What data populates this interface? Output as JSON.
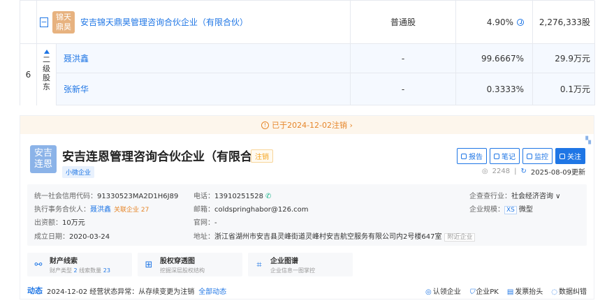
{
  "table": {
    "row1": {
      "logo_text": "锦天鼎昊",
      "collapse_symbol": "−",
      "name": "安吉锦天鼎昊管理咨询合伙企业（有限合伙）",
      "type": "普通股",
      "percent": "4.90%",
      "amount": "2,276,333股"
    },
    "index": "6",
    "level_label": "二级股东",
    "sub_rows": [
      {
        "name": "聂洪鑫",
        "type": "-",
        "percent": "99.6667%",
        "amount": "29.9万元"
      },
      {
        "name": "张新华",
        "type": "-",
        "percent": "0.3333%",
        "amount": "0.1万元"
      }
    ]
  },
  "card": {
    "banner": "已于2024-12-02注销 ›",
    "logo_text": "安吉连恩",
    "name": "安吉连恩管理咨询合伙企业（有限合伙）",
    "status_tag": "注销",
    "type_tag": "小微企业",
    "actions": [
      "报告",
      "笔记",
      "监控",
      "关注"
    ],
    "views": "2248",
    "updated": "2025-08-09更新",
    "info": {
      "credit_code_label": "统一社会信用代码：",
      "credit_code": "91330523MA2D1H6J89",
      "partner_label": "执行事务合伙人：",
      "partner": "聂洪鑫",
      "partner_tag": "关联企业 27",
      "capital_label": "出资额：",
      "capital": "10万元",
      "founded_label": "成立日期：",
      "founded": "2020-03-24",
      "phone_label": "电话：",
      "phone": "13910251528",
      "email_label": "邮箱：",
      "email": "coldspringhabor@126.com",
      "website_label": "官网：",
      "website": "-",
      "address_label": "地址：",
      "address": "浙江省湖州市安吉县灵峰街道灵峰村安吉航空服务有限公司内2号楼647室",
      "nearby": "附近企业",
      "industry_label": "企查查行业：",
      "industry": "社会经济咨询 ∨",
      "scale_label": "企业规模：",
      "scale_tag": "XS",
      "scale": "微型"
    },
    "features": [
      {
        "title": "财产线索",
        "sub_prefix": "财产类型 ",
        "n1": "2",
        "sub_mid": " 线索数量 ",
        "n2": "23"
      },
      {
        "title": "股权穿透图",
        "sub": "挖掘深层股权结构"
      },
      {
        "title": "企业图谱",
        "sub": "企业信息一图掌控"
      }
    ],
    "dynamic": {
      "title": "动态",
      "text": "2024-12-02 经营状态异常：从存续变更为注销",
      "all": "全部动态",
      "rights": [
        "认领企业",
        "企业PK",
        "发票抬头",
        "数据纠错"
      ]
    }
  }
}
